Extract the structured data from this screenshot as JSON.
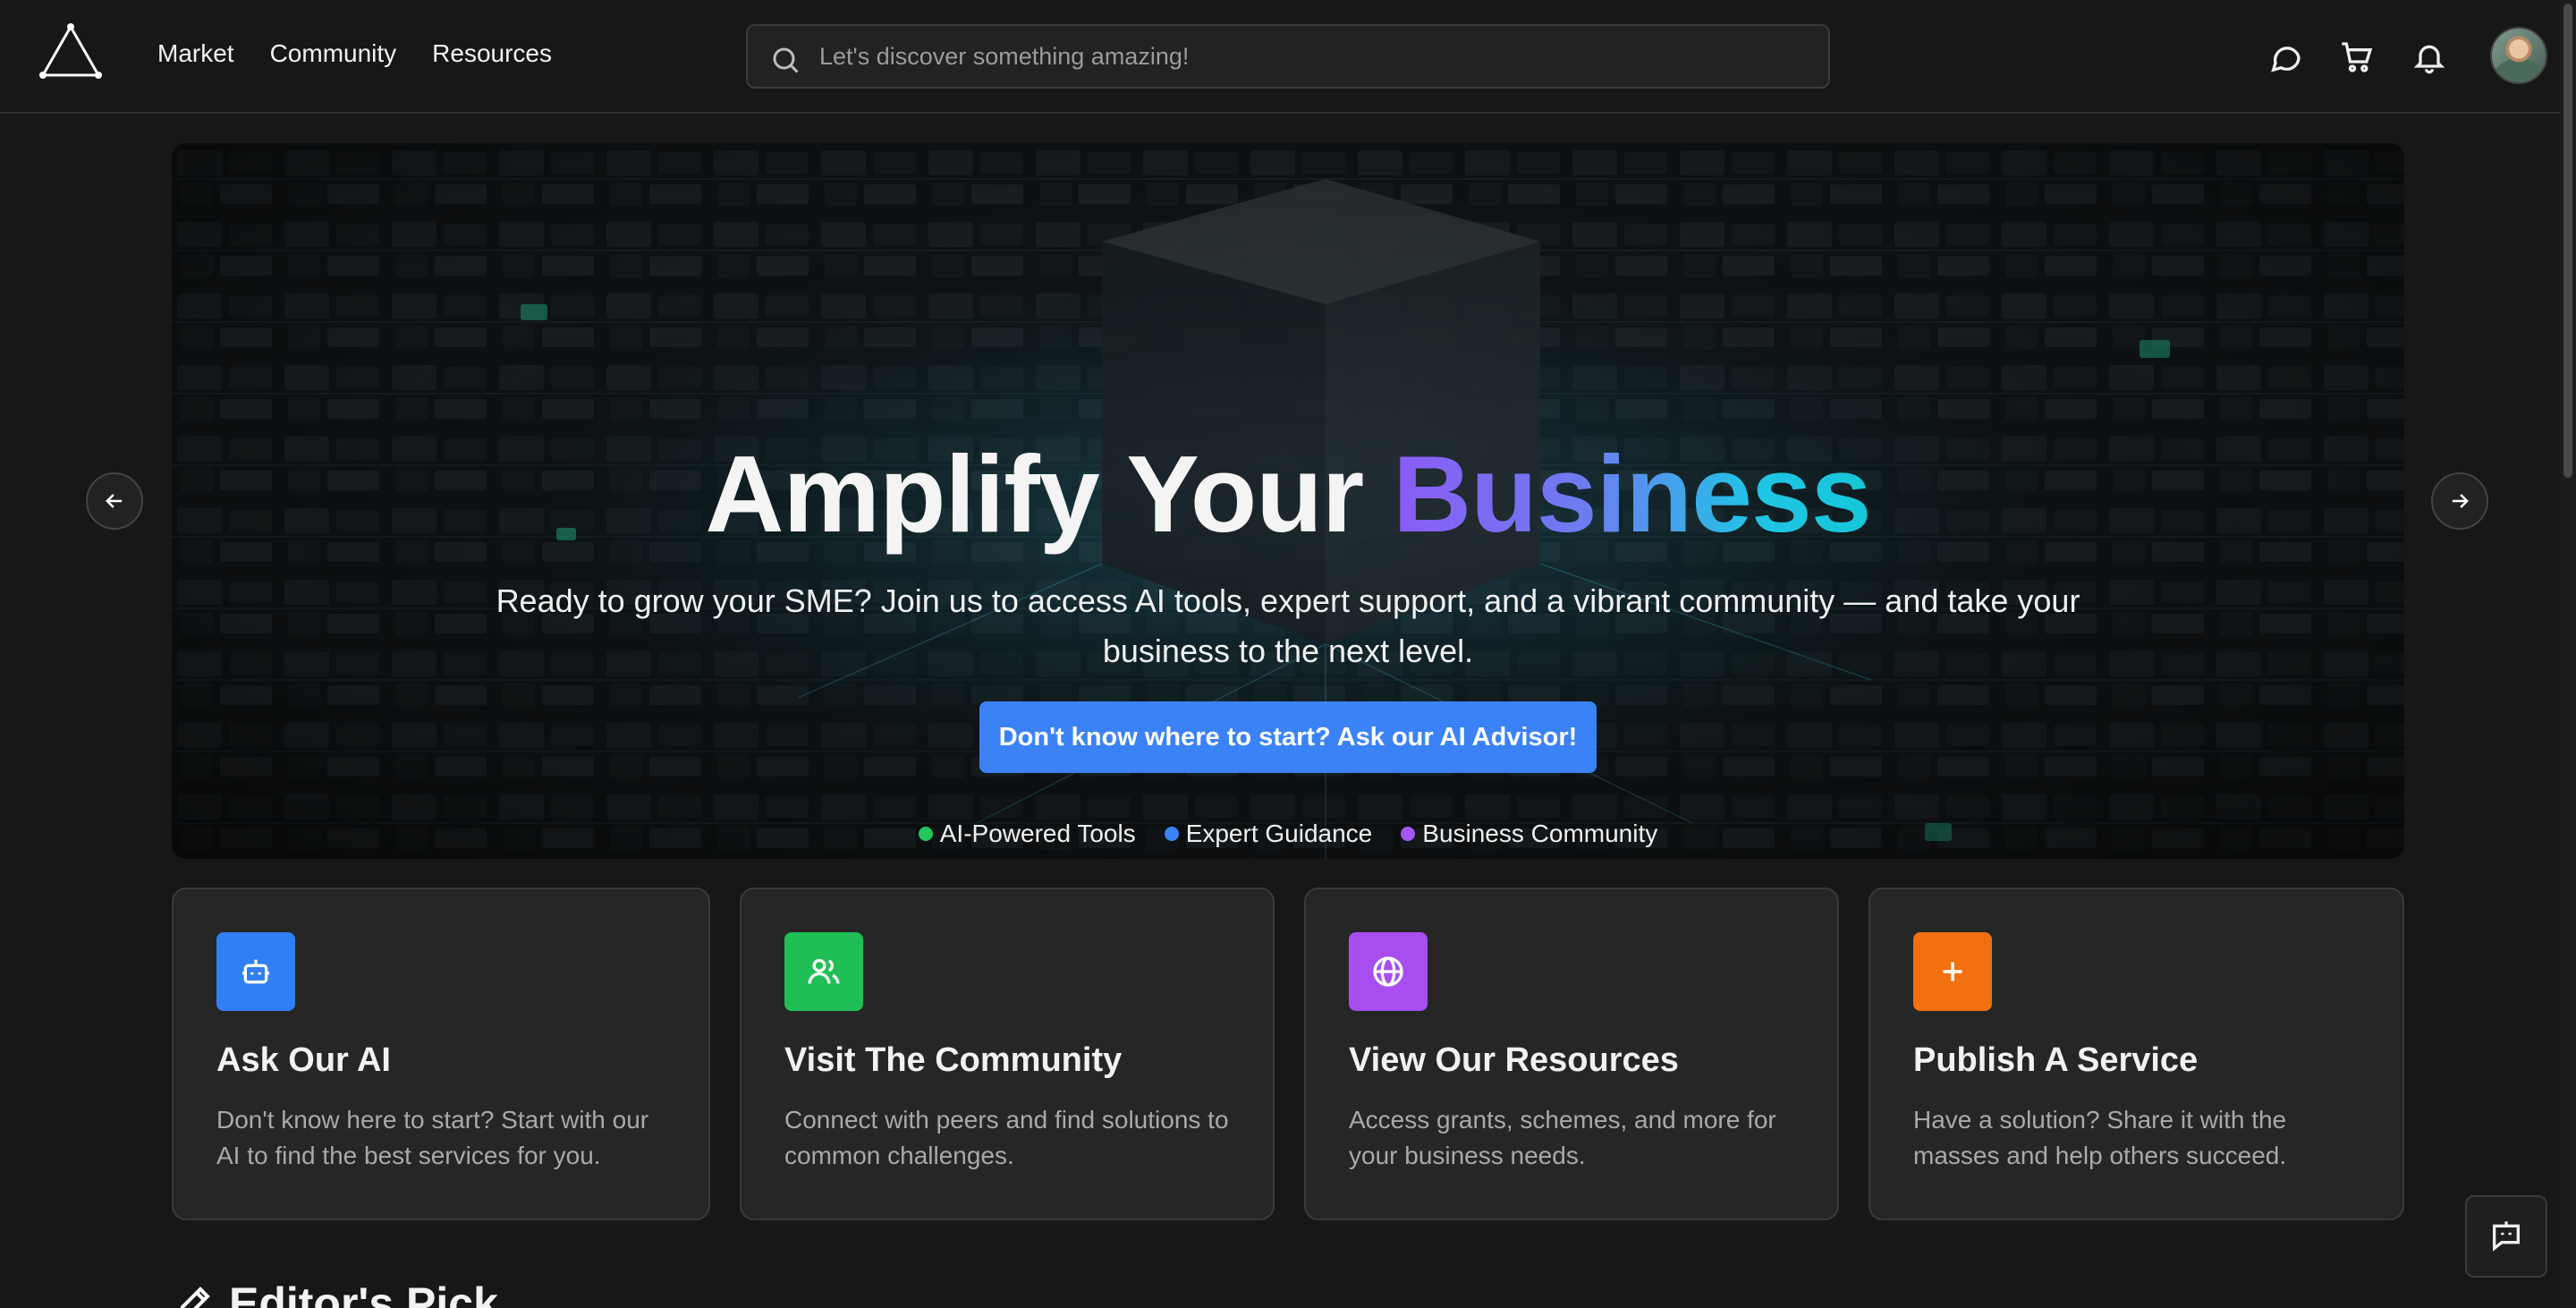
{
  "nav": {
    "items": [
      "Market",
      "Community",
      "Resources"
    ]
  },
  "search": {
    "placeholder": "Let's discover something amazing!"
  },
  "header_icons": [
    "chat-bubble-icon",
    "cart-icon",
    "bell-icon"
  ],
  "hero": {
    "title_plain": "Amplify Your ",
    "title_accent": "Business",
    "subtitle": "Ready to grow your SME? Join us to access AI tools, expert support, and a vibrant community — and take your business to the next level.",
    "cta_label": "Don't know where to start? Ask our AI Advisor!",
    "tags": [
      {
        "label": "AI-Powered Tools",
        "color": "#22c55e"
      },
      {
        "label": "Expert Guidance",
        "color": "#3b82f6"
      },
      {
        "label": "Business Community",
        "color": "#a855f7"
      }
    ]
  },
  "cards": [
    {
      "title": "Ask Our AI",
      "desc": "Don't know here to start? Start with our AI to find the best services for you.",
      "icon": "bot-icon",
      "color": "#2f7ff5"
    },
    {
      "title": "Visit The Community",
      "desc": "Connect with peers and find solutions to common challenges.",
      "icon": "users-icon",
      "color": "#1fbf55"
    },
    {
      "title": "View Our Resources",
      "desc": "Access grants, schemes, and more for your business needs.",
      "icon": "globe-icon",
      "color": "#a84df0"
    },
    {
      "title": "Publish A Service",
      "desc": "Have a solution? Share it with the masses and help others succeed.",
      "icon": "plus-icon",
      "color": "#f2700f"
    }
  ],
  "section": {
    "title": "Editor's Pick"
  },
  "colors": {
    "background": "#171717",
    "card": "#262626",
    "accent": "#3b82f6"
  }
}
